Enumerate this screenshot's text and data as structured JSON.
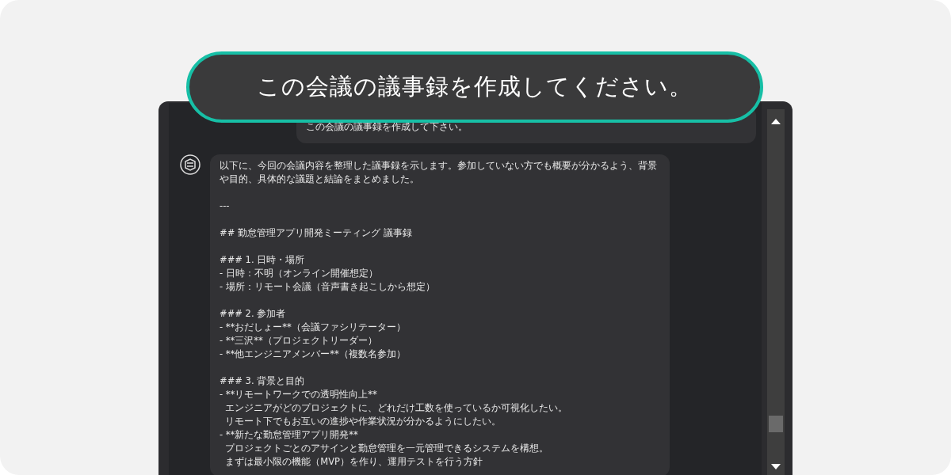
{
  "callout": {
    "text": "この会議の議事録を作成してください。"
  },
  "messages": [
    {
      "kind": "user",
      "blocks": [
        [
          "この会議の議事録を作成して下さい。"
        ]
      ]
    },
    {
      "kind": "assistant",
      "blocks": [
        [
          "以下に、今回の会議内容を整理した議事録を示します。参加していない方でも概要が分かるよう、背景や目的、具体的な議題と結論をまとめました。"
        ],
        [
          "---"
        ],
        [
          "## 勤怠管理アプリ開発ミーティング 議事録"
        ],
        [
          "### 1. 日時・場所",
          "- 日時：不明（オンライン開催想定）",
          "- 場所：リモート会議（音声書き起こしから想定）"
        ],
        [
          "### 2. 参加者",
          "- **おだしょー**（会議ファシリテーター）",
          "- **三沢**（プロジェクトリーダー）",
          "- **他エンジニアメンバー**（複数名参加）"
        ],
        [
          "### 3. 背景と目的",
          "- **リモートワークでの透明性向上**",
          "  エンジニアがどのプロジェクトに、どれだけ工数を使っているか可視化したい。",
          "  リモート下でもお互いの進捗や作業状況が分かるようにしたい。",
          "- **新たな勤怠管理アプリ開発**",
          "  プロジェクトごとのアサインと勤怠管理を一元管理できるシステムを構想。",
          "  まずは最小限の機能（MVP）を作り、運用テストを行う方針"
        ]
      ]
    }
  ]
}
